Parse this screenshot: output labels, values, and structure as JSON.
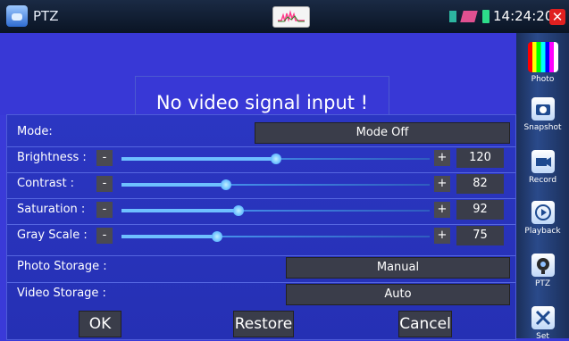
{
  "topbar": {
    "title": "PTZ",
    "time": "14:24:20",
    "close": "✕"
  },
  "video": {
    "message": "No video signal input  !"
  },
  "panel": {
    "mode": {
      "label": "Mode:",
      "value": "Mode Off"
    },
    "sliders": [
      {
        "label": "Brightness :",
        "minus": "-",
        "plus": "+",
        "value": "120",
        "level": 0.5
      },
      {
        "label": "Contrast :",
        "minus": "-",
        "plus": "+",
        "value": "82",
        "level": 0.34
      },
      {
        "label": "Saturation :",
        "minus": "-",
        "plus": "+",
        "value": "92",
        "level": 0.38
      },
      {
        "label": "Gray Scale :",
        "minus": "-",
        "plus": "+",
        "value": "75",
        "level": 0.31
      }
    ],
    "photo_storage": {
      "label": "Photo Storage :",
      "value": "Manual"
    },
    "video_storage": {
      "label": "Video Storage :",
      "value": "Auto"
    },
    "buttons": {
      "ok": "OK",
      "restore": "Restore",
      "cancel": "Cancel"
    }
  },
  "sidebar": {
    "items": [
      {
        "label": "Photo",
        "icon": "color-bars-icon"
      },
      {
        "label": "Snapshot",
        "icon": "camera-icon"
      },
      {
        "label": "Record",
        "icon": "video-camera-icon"
      },
      {
        "label": "Playback",
        "icon": "play-icon"
      },
      {
        "label": "PTZ",
        "icon": "ptz-camera-icon"
      },
      {
        "label": "Set",
        "icon": "tools-icon"
      }
    ]
  }
}
